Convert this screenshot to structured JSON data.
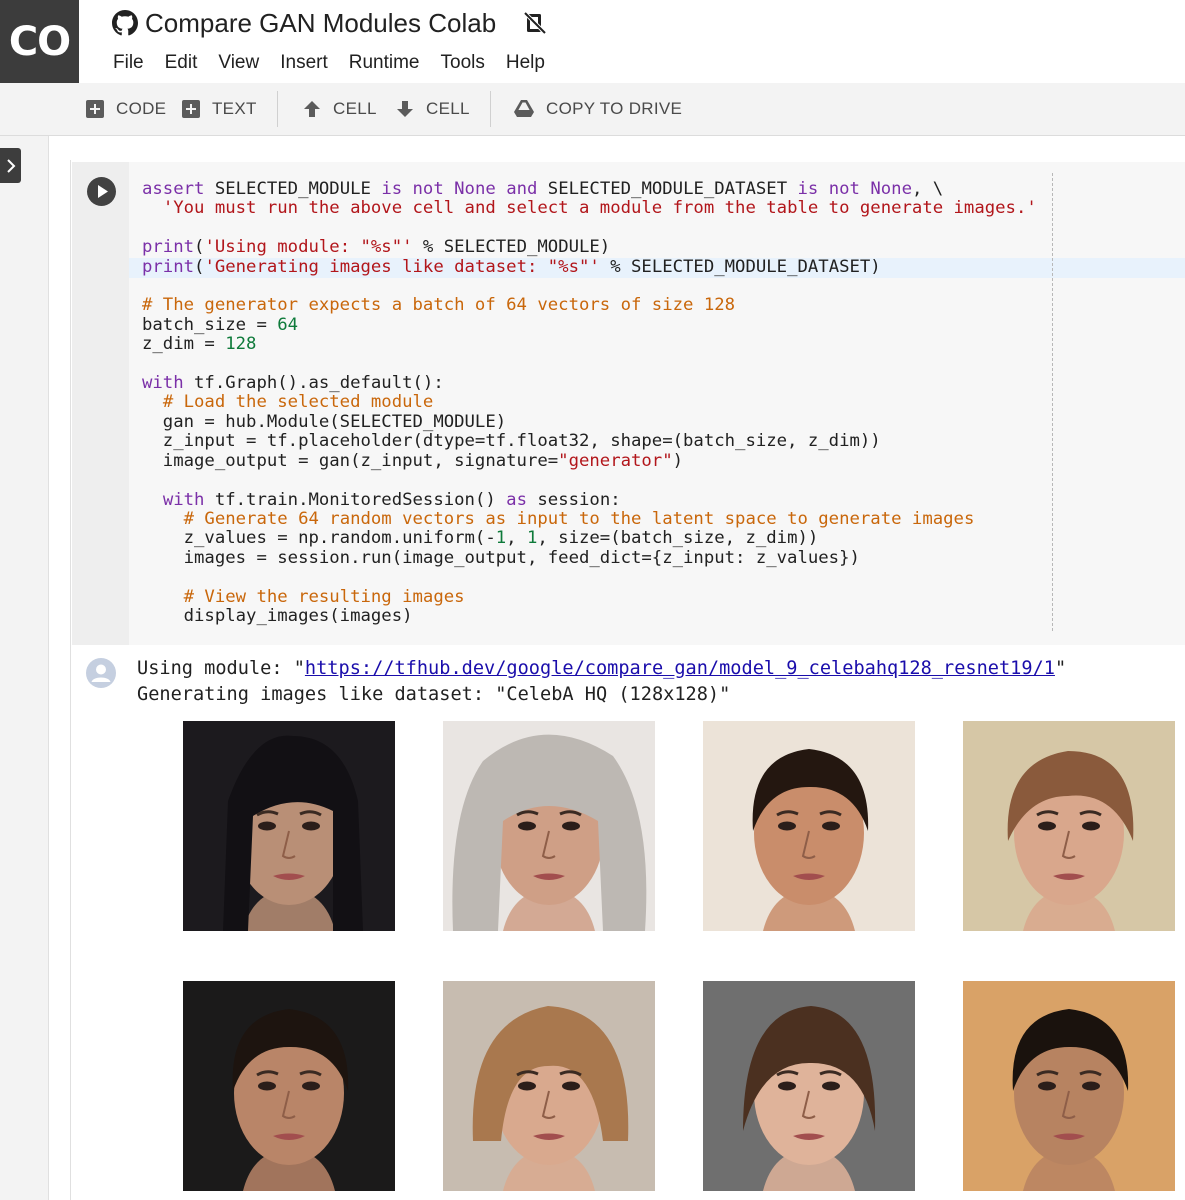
{
  "app": {
    "logo_text": "CO",
    "title": "Compare GAN Modules Colab",
    "title_icon": "github-icon",
    "drive_status_icon": "drive-off-icon"
  },
  "menu": [
    "File",
    "Edit",
    "View",
    "Insert",
    "Runtime",
    "Tools",
    "Help"
  ],
  "toolbar": {
    "add_code": "CODE",
    "add_text": "TEXT",
    "cell_up": "CELL",
    "cell_down": "CELL",
    "copy_to_drive": "COPY TO DRIVE"
  },
  "cell": {
    "code_lines": [
      "assert SELECTED_MODULE is not None and SELECTED_MODULE_DATASET is not None, \\",
      "  'You must run the above cell and select a module from the table to generate images.'",
      "",
      "print('Using module: \"%s\"' % SELECTED_MODULE)",
      "print('Generating images like dataset: \"%s\"' % SELECTED_MODULE_DATASET)",
      "",
      "# The generator expects a batch of 64 vectors of size 128",
      "batch_size = 64",
      "z_dim = 128",
      "",
      "with tf.Graph().as_default():",
      "  # Load the selected module",
      "  gan = hub.Module(SELECTED_MODULE)",
      "  z_input = tf.placeholder(dtype=tf.float32, shape=(batch_size, z_dim))",
      "  image_output = gan(z_input, signature=\"generator\")",
      "",
      "  with tf.train.MonitoredSession() as session:",
      "    # Generate 64 random vectors as input to the latent space to generate images",
      "    z_values = np.random.uniform(-1, 1, size=(batch_size, z_dim))",
      "    images = session.run(image_output, feed_dict={z_input: z_values})",
      "",
      "    # View the resulting images",
      "    display_images(images)"
    ]
  },
  "output": {
    "line1_prefix": "Using module: \"",
    "module_url": "https://tfhub.dev/google/compare_gan/model_9_celebahq128_resnet19/1",
    "line1_suffix": "\"",
    "line2": "Generating images like dataset: \"CelebA HQ (128x128)\"",
    "images": [
      {
        "bg": "#1c1a1e",
        "skin": "#b98f76",
        "hair": "#121014",
        "hair_style": "dark-long"
      },
      {
        "bg": "#e9e5e2",
        "skin": "#cf9f86",
        "hair": "#bdb8b3",
        "hair_style": "grey-wild"
      },
      {
        "bg": "#ece3d8",
        "skin": "#c98d6b",
        "hair": "#241710",
        "hair_style": "dark-short"
      },
      {
        "bg": "#d6c7a6",
        "skin": "#d9a78c",
        "hair": "#8a5a3c",
        "hair_style": "short-auburn"
      },
      {
        "bg": "#1b1a1a",
        "skin": "#b98568",
        "hair": "#1d140f",
        "hair_style": "dark-short"
      },
      {
        "bg": "#c7bcb0",
        "skin": "#d9a98e",
        "hair": "#a9784e",
        "hair_style": "light-bangs"
      },
      {
        "bg": "#6f6f6f",
        "skin": "#dfb39a",
        "hair": "#4b3020",
        "hair_style": "brown-updo"
      },
      {
        "bg": "#d9a267",
        "skin": "#b78361",
        "hair": "#1a120d",
        "hair_style": "dark-short"
      }
    ]
  }
}
